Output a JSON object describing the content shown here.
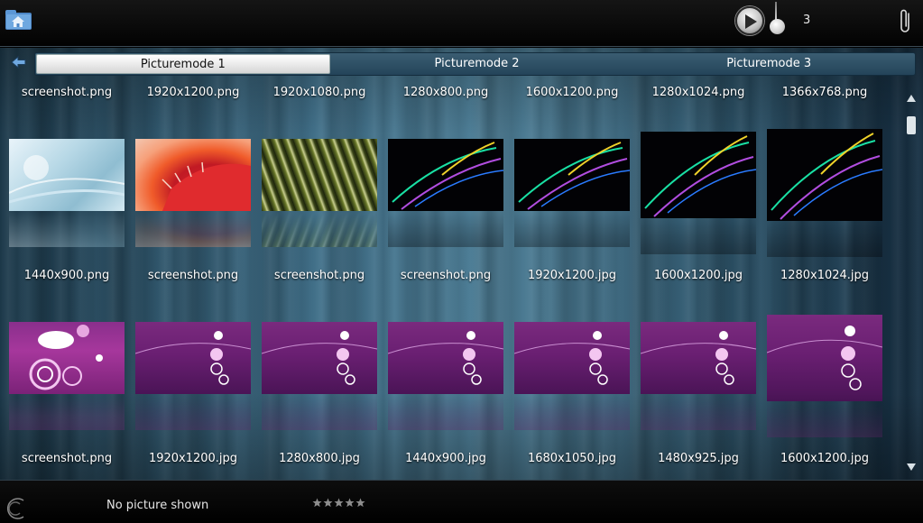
{
  "top": {
    "count": "3"
  },
  "tabs": [
    "Picturemode 1",
    "Picturemode 2",
    "Picturemode 3"
  ],
  "rows": [
    [
      "screenshot.png",
      "1920x1200.png",
      "1920x1080.png",
      "1280x800.png",
      "1600x1200.png",
      "1280x1024.png",
      "1366x768.png"
    ],
    [
      "1440x900.png",
      "screenshot.png",
      "screenshot.png",
      "screenshot.png",
      "1920x1200.jpg",
      "1600x1200.jpg",
      "1280x1024.jpg"
    ],
    [
      "screenshot.png",
      "1920x1200.jpg",
      "1280x800.jpg",
      "1440x900.jpg",
      "1680x1050.jpg",
      "1480x925.jpg",
      "1600x1200.jpg"
    ]
  ],
  "status": {
    "text": "No picture shown",
    "rating": 0,
    "rating_max": 5
  },
  "colors": {
    "accent": "#4d7d95",
    "bar": "#000000"
  }
}
